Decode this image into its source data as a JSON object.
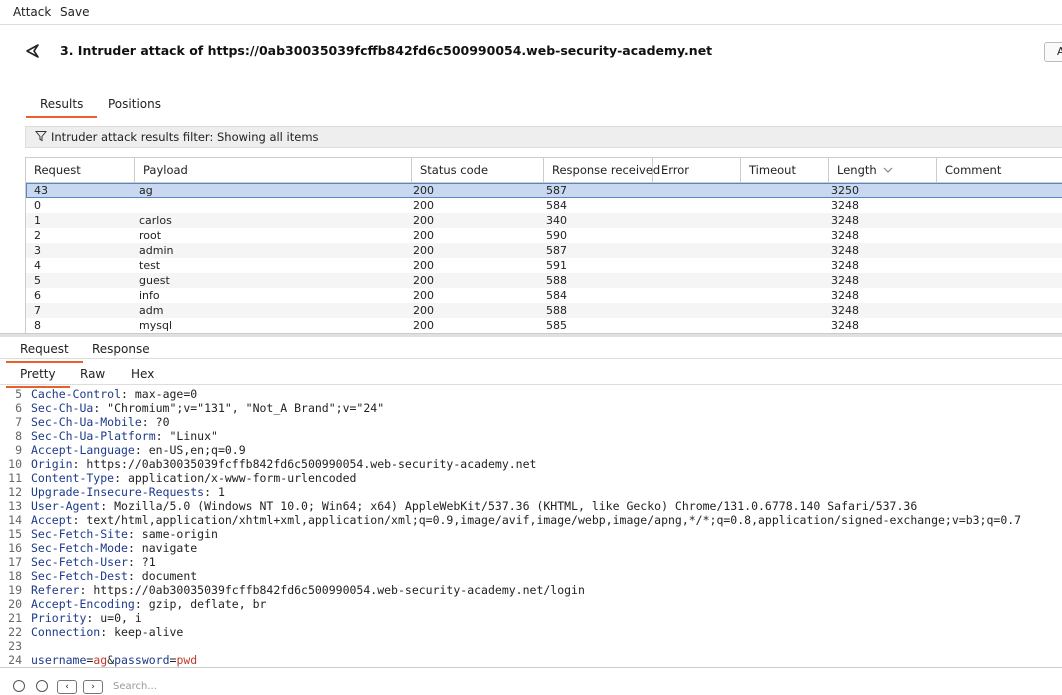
{
  "menubar": {
    "items": [
      "Attack",
      "Save"
    ]
  },
  "header": {
    "title": "3. Intruder attack of https://0ab30035039fcffb842fd6c500990054.web-security-academy.net",
    "right_button_label": "A"
  },
  "tabs_top": [
    "Results",
    "Positions"
  ],
  "filter": {
    "text": "Intruder attack results filter: Showing all items"
  },
  "table": {
    "columns": [
      "Request",
      "Payload",
      "Status code",
      "Response received",
      "Error",
      "Timeout",
      "Length",
      "Comment"
    ],
    "sort_indicator": "chevron-down",
    "rows": [
      {
        "request": "43",
        "payload": "ag",
        "status": "200",
        "response": "587",
        "error": "",
        "timeout": "",
        "length": "3250",
        "comment": ""
      },
      {
        "request": "0",
        "payload": "",
        "status": "200",
        "response": "584",
        "error": "",
        "timeout": "",
        "length": "3248",
        "comment": ""
      },
      {
        "request": "1",
        "payload": "carlos",
        "status": "200",
        "response": "340",
        "error": "",
        "timeout": "",
        "length": "3248",
        "comment": ""
      },
      {
        "request": "2",
        "payload": "root",
        "status": "200",
        "response": "590",
        "error": "",
        "timeout": "",
        "length": "3248",
        "comment": ""
      },
      {
        "request": "3",
        "payload": "admin",
        "status": "200",
        "response": "587",
        "error": "",
        "timeout": "",
        "length": "3248",
        "comment": ""
      },
      {
        "request": "4",
        "payload": "test",
        "status": "200",
        "response": "591",
        "error": "",
        "timeout": "",
        "length": "3248",
        "comment": ""
      },
      {
        "request": "5",
        "payload": "guest",
        "status": "200",
        "response": "588",
        "error": "",
        "timeout": "",
        "length": "3248",
        "comment": ""
      },
      {
        "request": "6",
        "payload": "info",
        "status": "200",
        "response": "584",
        "error": "",
        "timeout": "",
        "length": "3248",
        "comment": ""
      },
      {
        "request": "7",
        "payload": "adm",
        "status": "200",
        "response": "588",
        "error": "",
        "timeout": "",
        "length": "3248",
        "comment": ""
      },
      {
        "request": "8",
        "payload": "mysql",
        "status": "200",
        "response": "585",
        "error": "",
        "timeout": "",
        "length": "3248",
        "comment": ""
      }
    ]
  },
  "tabs_mid": [
    "Request",
    "Response"
  ],
  "tabs_view": [
    "Pretty",
    "Raw",
    "Hex"
  ],
  "editor": {
    "lines": [
      {
        "n": "5",
        "key": "Cache-Control",
        "val": " max-age=0"
      },
      {
        "n": "6",
        "key": "Sec-Ch-Ua",
        "val": " \"Chromium\";v=\"131\", \"Not_A Brand\";v=\"24\""
      },
      {
        "n": "7",
        "key": "Sec-Ch-Ua-Mobile",
        "val": " ?0"
      },
      {
        "n": "8",
        "key": "Sec-Ch-Ua-Platform",
        "val": " \"Linux\""
      },
      {
        "n": "9",
        "key": "Accept-Language",
        "val": " en-US,en;q=0.9"
      },
      {
        "n": "10",
        "key": "Origin",
        "val": " https://0ab30035039fcffb842fd6c500990054.web-security-academy.net"
      },
      {
        "n": "11",
        "key": "Content-Type",
        "val": " application/x-www-form-urlencoded"
      },
      {
        "n": "12",
        "key": "Upgrade-Insecure-Requests",
        "val": " 1"
      },
      {
        "n": "13",
        "key": "User-Agent",
        "val": " Mozilla/5.0 (Windows NT 10.0; Win64; x64) AppleWebKit/537.36 (KHTML, like Gecko) Chrome/131.0.6778.140 Safari/537.36"
      },
      {
        "n": "14",
        "key": "Accept",
        "val": " text/html,application/xhtml+xml,application/xml;q=0.9,image/avif,image/webp,image/apng,*/*;q=0.8,application/signed-exchange;v=b3;q=0.7"
      },
      {
        "n": "15",
        "key": "Sec-Fetch-Site",
        "val": " same-origin"
      },
      {
        "n": "16",
        "key": "Sec-Fetch-Mode",
        "val": " navigate"
      },
      {
        "n": "17",
        "key": "Sec-Fetch-User",
        "val": " ?1"
      },
      {
        "n": "18",
        "key": "Sec-Fetch-Dest",
        "val": " document"
      },
      {
        "n": "19",
        "key": "Referer",
        "val": " https://0ab30035039fcffb842fd6c500990054.web-security-academy.net/login"
      },
      {
        "n": "20",
        "key": "Accept-Encoding",
        "val": " gzip, deflate, br"
      },
      {
        "n": "21",
        "key": "Priority",
        "val": " u=0, i"
      },
      {
        "n": "22",
        "key": "Connection",
        "val": " keep-alive"
      },
      {
        "n": "23",
        "key": "",
        "val": ""
      }
    ],
    "body_line": {
      "n": "24",
      "k1": "username",
      "eq1": "=",
      "v1": "ag",
      "amp": "&",
      "k2": "password",
      "eq2": "=",
      "v2": "pwd"
    }
  },
  "bottom": {
    "search_placeholder": "Search..."
  }
}
